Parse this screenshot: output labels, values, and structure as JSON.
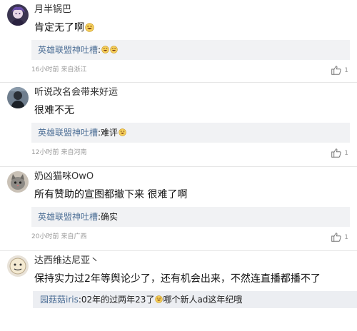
{
  "comments": [
    {
      "username": "月半锅巴",
      "text": "肯定无了啊",
      "text_emoji": "grin-emoji",
      "reply_name": "英雄联盟神吐槽",
      "reply_text": ":",
      "reply_emojis": [
        "grin-emoji",
        "grin-emoji"
      ],
      "time": "16小时前",
      "location": "来自浙江",
      "likes": "1"
    },
    {
      "username": "听说改名会带来好运",
      "text": "很难不无",
      "reply_name": "英雄联盟神吐槽",
      "reply_text": ":难评",
      "reply_emojis": [
        "grin-emoji"
      ],
      "time": "12小时前",
      "location": "来自河南",
      "likes": "1"
    },
    {
      "username": "奶凶猫咪OwO",
      "text": "所有赞助的宣图都撤下来 很难了啊",
      "reply_name": "英雄联盟神吐槽",
      "reply_text": ":确实",
      "time": "20小时前",
      "location": "来自广西",
      "likes": "1"
    },
    {
      "username": "达西维达尼亚丶",
      "text": "保持实力过2年等舆论少了，还有机会出来，不然连直播都播不了",
      "reply_name": "园菇菇iris",
      "reply_text": ":02年的过两年23了",
      "reply_emoji": "grin-emoji",
      "reply_text_after": "哪个新人ad这年纪哦"
    }
  ],
  "colors": {
    "reply_name": "#4d6f96",
    "meta": "#999999",
    "reply_bg": "#f1f2f4"
  }
}
